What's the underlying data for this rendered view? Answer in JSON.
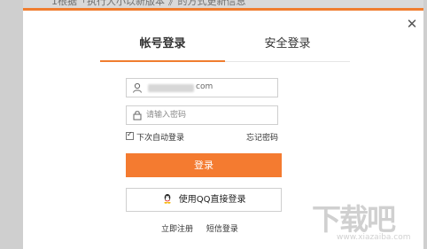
{
  "background": {
    "top_text": "1根据「执行大小以新版本 》的方式更新信息"
  },
  "dialog": {
    "close_symbol": "✕",
    "tabs": [
      {
        "label": "帐号登录",
        "active": true
      },
      {
        "label": "安全登录",
        "active": false
      }
    ],
    "username": {
      "value_suffix": "com"
    },
    "password": {
      "placeholder": "请输入密码"
    },
    "auto_login": {
      "label": "下次自动登录",
      "checked": true
    },
    "forgot_label": "忘记密码",
    "login_button": "登录",
    "qq_button": "使用QQ直接登录",
    "register_link": "立即注册",
    "sms_login_link": "短信登录"
  },
  "colors": {
    "accent": "#f47b30",
    "accent_line": "#f07d2f"
  },
  "watermark": {
    "big": "下载吧",
    "small": "www.xiazaiba.com"
  }
}
